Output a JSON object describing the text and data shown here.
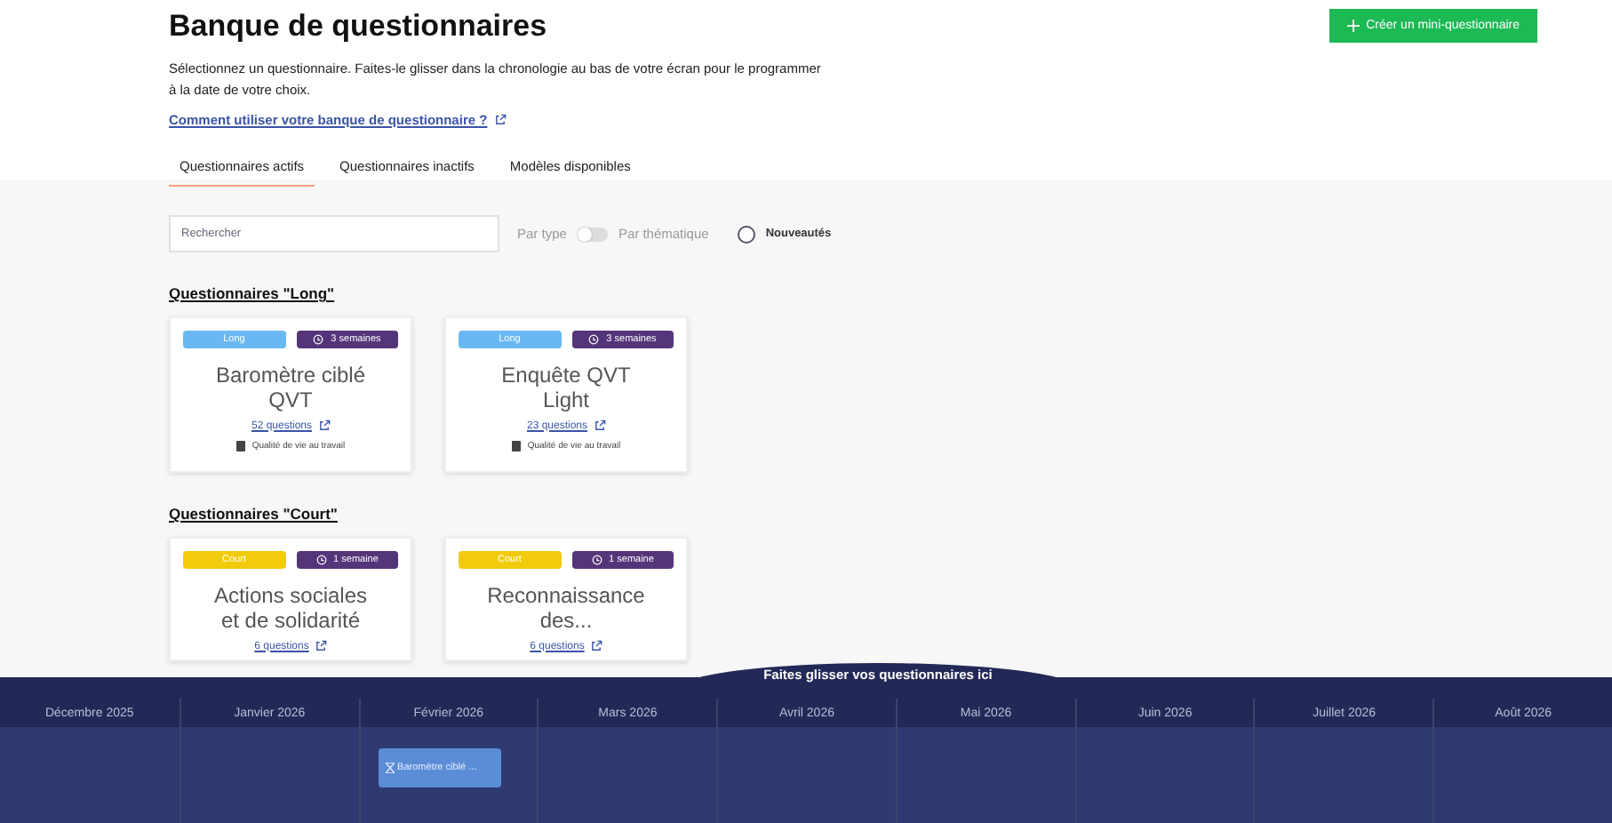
{
  "header": {
    "title": "Banque de questionnaires",
    "create_button": "Créer un mini-questionnaire",
    "intro": "Sélectionnez un questionnaire. Faites-le glisser dans la chronologie au bas de votre écran pour le programmer à la date de votre choix.",
    "help_link": "Comment utiliser votre banque de questionnaire ?"
  },
  "tabs": [
    {
      "label": "Questionnaires actifs",
      "selected": true
    },
    {
      "label": "Questionnaires inactifs",
      "selected": false
    },
    {
      "label": "Modèles disponibles",
      "selected": false
    }
  ],
  "filters": {
    "search": {
      "placeholder": "Rechercher"
    },
    "toggle_left": "Par type",
    "toggle_right": "Par thématique",
    "toggle_on": false,
    "news": {
      "label": "Nouveautés",
      "checked": false
    }
  },
  "sections": [
    {
      "title": "Questionnaires \"Long\"",
      "cards": [
        {
          "type": "Long",
          "color": "#6ab8f2",
          "duration": "3 semaines",
          "title": "Baromètre ciblé QVT",
          "questions": "52 questions",
          "theme": "Qualité de vie au travail"
        },
        {
          "type": "Long",
          "color": "#6ab8f2",
          "duration": "3 semaines",
          "title": "Enquête QVT Light",
          "questions": "23 questions",
          "theme": "Qualité de vie au travail"
        }
      ]
    },
    {
      "title": "Questionnaires \"Court\"",
      "cards": [
        {
          "type": "Court",
          "color": "#f2cc0c",
          "duration": "1 semaine",
          "title": "Actions sociales et de solidarité",
          "questions": "6 questions"
        },
        {
          "type": "Court",
          "color": "#f2cc0c",
          "duration": "1 semaine",
          "title": "Reconnaissance des...",
          "questions": "6 questions"
        }
      ]
    }
  ],
  "timeline": {
    "tab": "Faites glisser vos questionnaires ici",
    "months": [
      {
        "label": "Décembre 2025"
      },
      {
        "label": "Janvier 2026"
      },
      {
        "label": "Février 2026",
        "events": [
          {
            "label": "Baromètre ciblé ..."
          }
        ]
      },
      {
        "label": "Mars 2026"
      },
      {
        "label": "Avril 2026"
      },
      {
        "label": "Mai 2026"
      },
      {
        "label": "Juin 2026"
      },
      {
        "label": "Juillet 2026"
      },
      {
        "label": "Août 2026"
      }
    ]
  }
}
